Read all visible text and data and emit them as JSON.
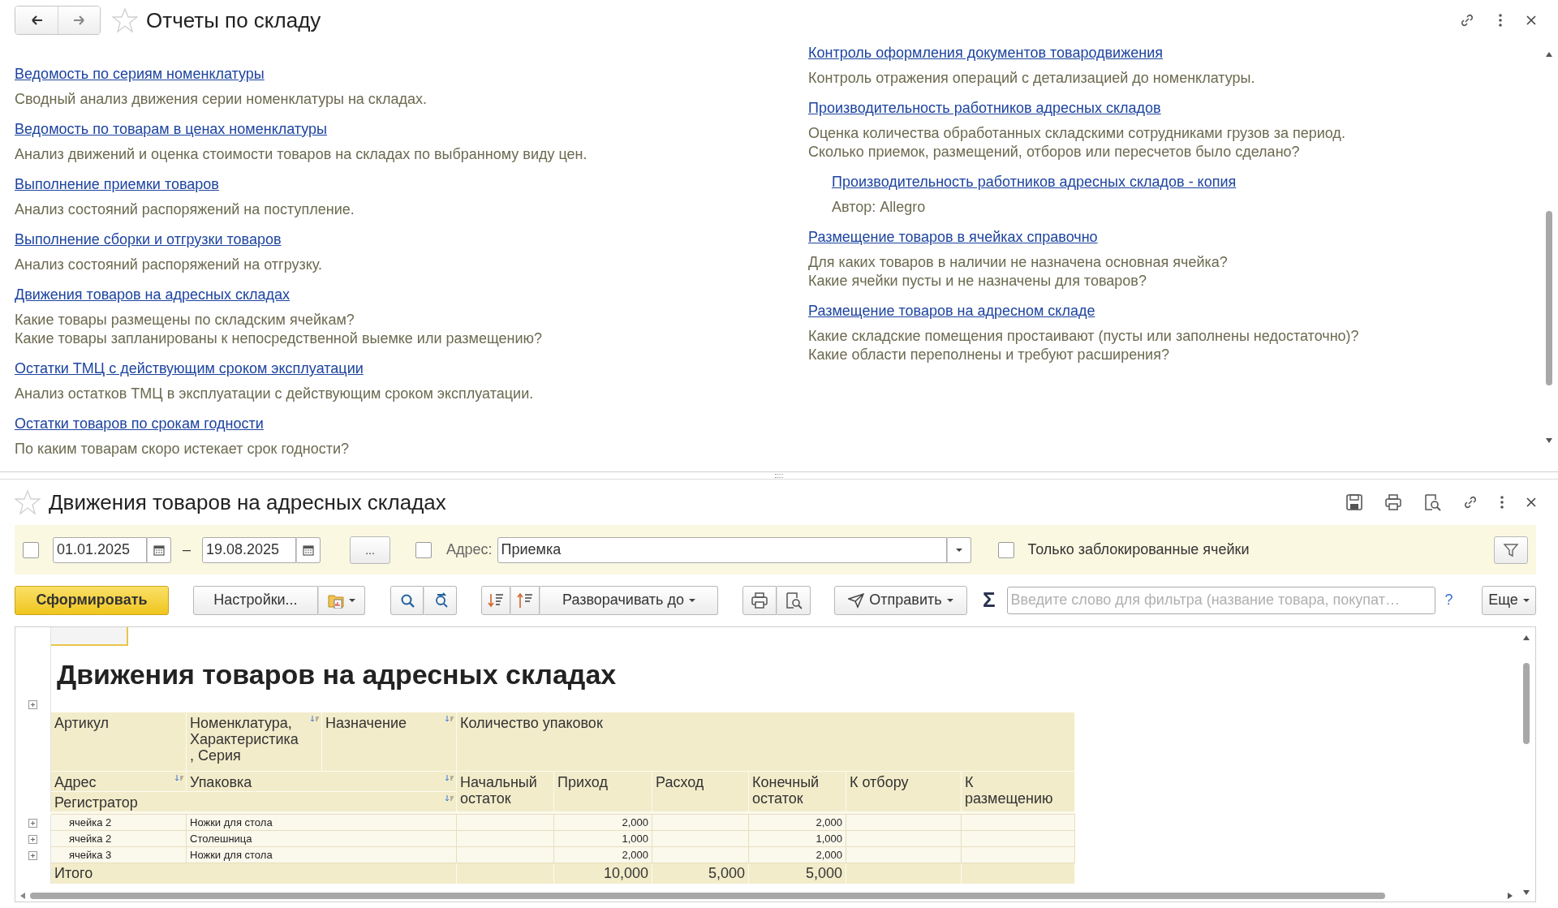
{
  "reports_window": {
    "title": "Отчеты по складу",
    "columns": [
      [
        {
          "link": "Ведомость по сериям номенклатуры",
          "description": "Сводный анализ движения серии номенклатуры на складах."
        },
        {
          "link": "Ведомость по товарам в ценах номенклатуры",
          "description": "Анализ движений и оценка стоимости товаров на складах по выбранному виду цен."
        },
        {
          "link": "Выполнение приемки товаров",
          "description": "Анализ состояний распоряжений на поступление."
        },
        {
          "link": "Выполнение сборки и отгрузки товаров",
          "description": "Анализ состояний распоряжений на отгрузку."
        },
        {
          "link": "Движения товаров на адресных складах",
          "description": "Какие товары размещены по складским ячейкам?\nКакие товары запланированы к непосредственной выемке или размещению?"
        },
        {
          "link": "Остатки ТМЦ с действующим сроком эксплуатации",
          "description": "Анализ остатков ТМЦ в эксплуатации с действующим сроком эксплуатации."
        },
        {
          "link": "Остатки товаров по срокам годности",
          "description": "По каким товарам скоро истекает срок годности?"
        }
      ],
      [
        {
          "link": "Контроль оформления документов товародвижения",
          "description": "Контроль отражения операций с детализацией до номенклатуры."
        },
        {
          "link": "Производительность работников адресных складов",
          "description": "Оценка количества обработанных складскими сотрудниками грузов за период.\nСколько приемок, размещений, отборов или пересчетов было сделано?",
          "children": [
            {
              "link": "Производительность работников адресных складов - копия",
              "description": "Автор: Allegro"
            }
          ]
        },
        {
          "link": "Размещение товаров в ячейках справочно",
          "description": "Для каких товаров в наличии не назначена основная ячейка?\nКакие ячейки пусты и не назначены для товаров?"
        },
        {
          "link": "Размещение товаров на адресном складе",
          "description": "Какие складские помещения простаивают (пусты или заполнены недостаточно)?\nКакие области переполнены и требуют расширения?"
        }
      ]
    ]
  },
  "report_window": {
    "title": "Движения товаров на адресных складах",
    "filters": {
      "period": {
        "checked": false,
        "from": "01.01.2025",
        "separator": "–",
        "to": "19.08.2025",
        "more": "..."
      },
      "address": {
        "checked": false,
        "label": "Адрес:",
        "value": "Приемка"
      },
      "blocked_only": {
        "checked": false,
        "label": "Только заблокированные ячейки"
      }
    },
    "toolbar": {
      "generate": "Сформировать",
      "settings": "Настройки...",
      "expand": "Разворачивать до",
      "send": "Отправить",
      "sum": "Σ",
      "filter_placeholder": "Введите слово для фильтра (название товара, покупат…",
      "help": "?",
      "more": "Еще"
    },
    "report": {
      "title": "Движения товаров на адресных складах",
      "header_top": [
        {
          "text": "Артикул",
          "sortable": false
        },
        {
          "text": "Номенклатура,\nХарактеристика\n, Серия",
          "sortable": true
        },
        {
          "text": "Назначение",
          "sortable": true
        },
        {
          "text": "Количество упаковок",
          "sortable": false
        }
      ],
      "header_second": [
        {
          "text": "Адрес",
          "sortable": true
        },
        {
          "text": "Упаковка",
          "sortable": true
        },
        {
          "text": "Регистратор",
          "sortable": true
        }
      ],
      "quantity_columns": [
        "Начальный\nостаток",
        "Приход",
        "Расход",
        "Конечный\nостаток",
        "К отбору",
        "К\nразмещению"
      ],
      "rows": [
        {
          "expanded": false,
          "address": "ячейка 2",
          "item": "Ножки для стола",
          "values": {
            "receipt": "2,000",
            "closing": "2,000"
          }
        },
        {
          "expanded": false,
          "address": "ячейка 2",
          "item": "Столешница",
          "values": {
            "receipt": "1,000",
            "closing": "1,000"
          }
        },
        {
          "expanded": false,
          "address": "ячейка 3",
          "item": "Ножки для стола",
          "values": {
            "receipt": "2,000",
            "closing": "2,000"
          }
        }
      ],
      "total": {
        "label": "Итого",
        "values": {
          "receipt": "10,000",
          "expense": "5,000",
          "closing": "5,000"
        }
      }
    }
  }
}
